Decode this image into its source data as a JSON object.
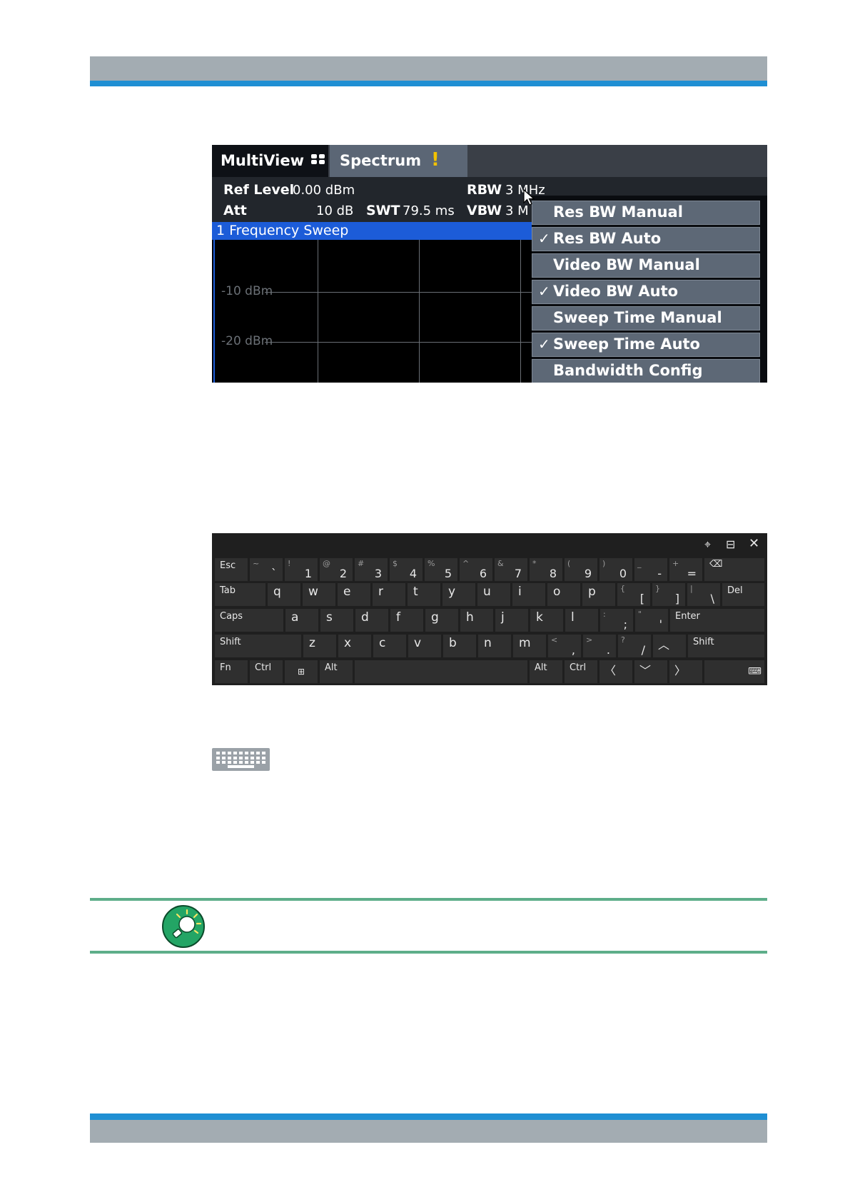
{
  "analyzer": {
    "tabs": {
      "multiview": "MultiView",
      "spectrum": "Spectrum",
      "warning": "!"
    },
    "info": {
      "ref_level_label": "Ref Level",
      "ref_level_value": "0.00 dBm",
      "att_label": "Att",
      "att_value": "10 dB",
      "swt_label": "SWT",
      "swt_value": "79.5 ms",
      "rbw_label": "RBW",
      "rbw_value": "3 MHz",
      "vbw_label": "VBW",
      "vbw_value": "3 M"
    },
    "sweep_title": "1 Frequency Sweep",
    "y_labels": [
      "-10 dBm",
      "-20 dBm"
    ],
    "menu": [
      {
        "label": "Res BW Manual",
        "check": ""
      },
      {
        "label": "Res BW Auto",
        "check": "✓"
      },
      {
        "label": "Video BW Manual",
        "check": ""
      },
      {
        "label": "Video BW Auto",
        "check": "✓"
      },
      {
        "label": "Sweep Time Manual",
        "check": ""
      },
      {
        "label": "Sweep Time Auto",
        "check": "✓"
      },
      {
        "label": "Bandwidth Config",
        "check": ""
      }
    ]
  },
  "keyboard": {
    "window_controls": {
      "move": "⌖",
      "dock": "⊟",
      "close": "✕"
    },
    "row1": {
      "esc": "Esc",
      "keys": [
        {
          "sec": "~",
          "pri": "`"
        },
        {
          "sec": "!",
          "pri": "1"
        },
        {
          "sec": "@",
          "pri": "2"
        },
        {
          "sec": "#",
          "pri": "3"
        },
        {
          "sec": "$",
          "pri": "4"
        },
        {
          "sec": "%",
          "pri": "5"
        },
        {
          "sec": "^",
          "pri": "6"
        },
        {
          "sec": "&",
          "pri": "7"
        },
        {
          "sec": "*",
          "pri": "8"
        },
        {
          "sec": "(",
          "pri": "9"
        },
        {
          "sec": ")",
          "pri": "0"
        },
        {
          "sec": "_",
          "pri": "-"
        },
        {
          "sec": "+",
          "pri": "="
        }
      ],
      "backspace": "⌫"
    },
    "row2": {
      "tab": "Tab",
      "letters": [
        "q",
        "w",
        "e",
        "r",
        "t",
        "y",
        "u",
        "i",
        "o",
        "p"
      ],
      "brackets": [
        {
          "sec": "{",
          "pri": "["
        },
        {
          "sec": "}",
          "pri": "]"
        },
        {
          "sec": "|",
          "pri": "\\"
        }
      ],
      "del": "Del"
    },
    "row3": {
      "caps": "Caps",
      "letters": [
        "a",
        "s",
        "d",
        "f",
        "g",
        "h",
        "j",
        "k",
        "l"
      ],
      "punct": [
        {
          "sec": ":",
          "pri": ";"
        },
        {
          "sec": "\"",
          "pri": "'"
        }
      ],
      "enter": "Enter"
    },
    "row4": {
      "shift_left": "Shift",
      "letters": [
        "z",
        "x",
        "c",
        "v",
        "b",
        "n",
        "m"
      ],
      "punct": [
        {
          "sec": "<",
          "pri": ","
        },
        {
          "sec": ">",
          "pri": "."
        },
        {
          "sec": "?",
          "pri": "/"
        }
      ],
      "up": "︿",
      "shift_right": "Shift"
    },
    "row5": {
      "fn": "Fn",
      "ctrl_left": "Ctrl",
      "win": "⊞",
      "alt_left": "Alt",
      "alt_right": "Alt",
      "ctrl_right": "Ctrl",
      "left": "〈",
      "down": "﹀",
      "right": "〉",
      "keyboard_menu": "⌨"
    }
  }
}
